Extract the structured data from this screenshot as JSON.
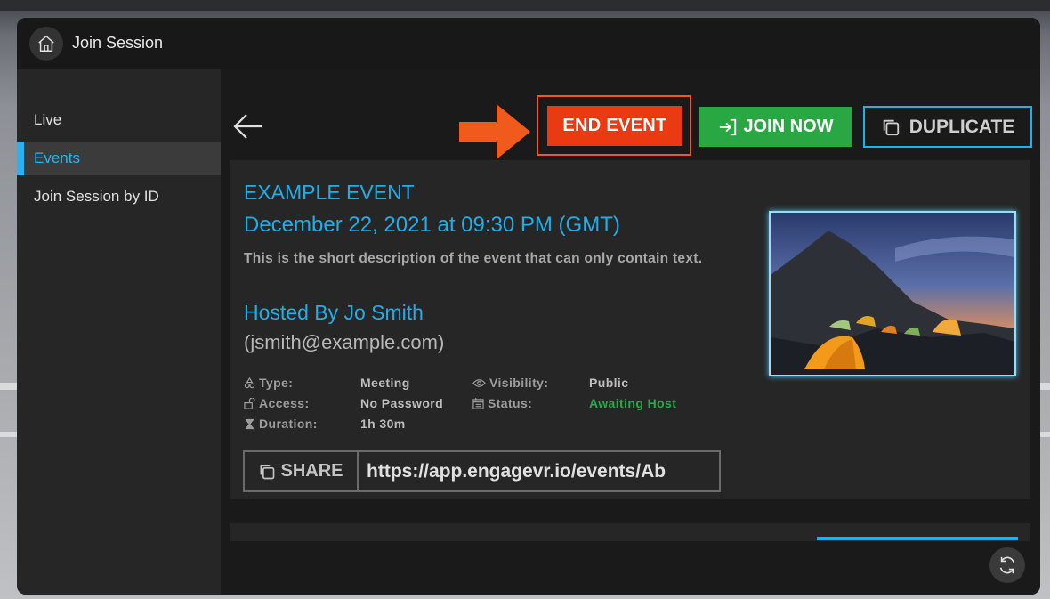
{
  "window": {
    "title": "Join Session"
  },
  "sidebar": {
    "items": [
      {
        "label": "Live",
        "active": false
      },
      {
        "label": "Events",
        "active": true
      },
      {
        "label": "Join Session by ID",
        "active": false
      }
    ]
  },
  "toolbar": {
    "end_event_label": "END EVENT",
    "join_now_label": "JOIN NOW",
    "duplicate_label": "DUPLICATE"
  },
  "event": {
    "title": "EXAMPLE EVENT",
    "datetime": "December 22, 2021 at 09:30 PM (GMT)",
    "description": "This is the short description of the event that can only contain text.",
    "host": "Hosted By Jo Smith",
    "host_email": "(jsmith@example.com)",
    "details": {
      "type_label": "Type:",
      "type_value": "Meeting",
      "access_label": "Access:",
      "access_value": "No Password",
      "duration_label": "Duration:",
      "duration_value": "1h 30m",
      "visibility_label": "Visibility:",
      "visibility_value": "Public",
      "status_label": "Status:",
      "status_value": "Awaiting Host"
    },
    "share": {
      "label": "SHARE",
      "url": "https://app.engagevr.io/events/Ab"
    }
  },
  "colors": {
    "accent": "#1faee8",
    "end_event": "#ea3a12",
    "join_now": "#29a743",
    "status_awaiting": "#2ba84a",
    "highlight_arrow": "#f05a1c"
  },
  "icons": [
    "home-icon",
    "back-arrow-icon",
    "login-icon",
    "copy-icon",
    "type-icon",
    "lock-icon",
    "hourglass-icon",
    "eye-icon",
    "calendar-icon",
    "refresh-icon"
  ]
}
